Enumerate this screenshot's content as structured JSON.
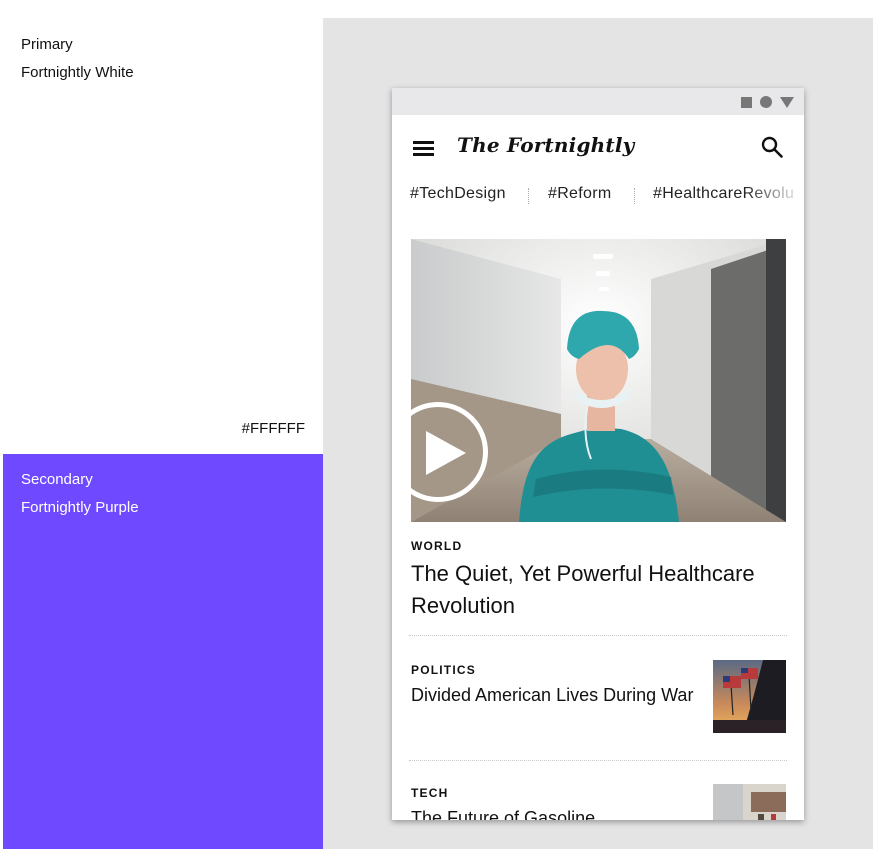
{
  "swatches": {
    "primary": {
      "role": "Primary",
      "name": "Fortnightly White",
      "hex": "#FFFFFF"
    },
    "secondary": {
      "role": "Secondary",
      "name": "Fortnightly Purple",
      "color": "#6E49FF"
    }
  },
  "app": {
    "logo": "The Fortnightly",
    "icons": {
      "menu": "menu-icon",
      "search": "search-icon"
    },
    "status_icons": [
      "square-icon",
      "circle-icon",
      "triangle-icon"
    ],
    "tags": [
      "#TechDesign",
      "#Reform",
      "#HealthcareRevolu"
    ]
  },
  "articles": [
    {
      "category": "WORLD",
      "title": "The Quiet, Yet Powerful Healthcare Revolution",
      "media": "video"
    },
    {
      "category": "POLITICS",
      "title": "Divided American Lives During War"
    },
    {
      "category": "TECH",
      "title": "The Future of Gasoline"
    }
  ]
}
